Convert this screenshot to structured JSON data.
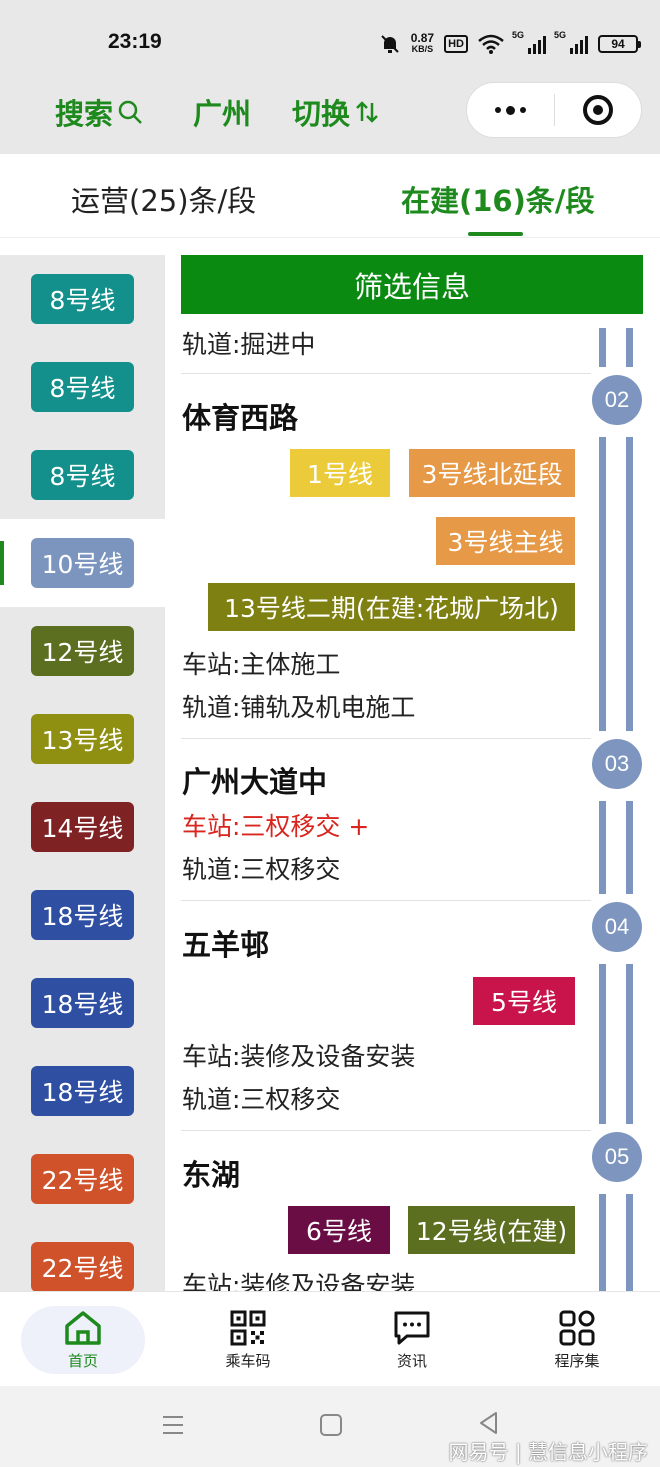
{
  "status": {
    "time": "23:19",
    "speed_value": "0.87",
    "speed_unit": "KB/S",
    "hd": "HD",
    "net1": "5G",
    "net2": "5G",
    "battery": "94"
  },
  "header": {
    "search_label": "搜索",
    "city_label": "广州",
    "switch_label": "切换"
  },
  "tabs": [
    {
      "label": "运营(25)条/段"
    },
    {
      "label": "在建(16)条/段"
    }
  ],
  "sidebar": {
    "items": [
      {
        "label": "8号线",
        "color": "#13908c"
      },
      {
        "label": "8号线",
        "color": "#13908c"
      },
      {
        "label": "8号线",
        "color": "#13908c"
      },
      {
        "label": "10号线",
        "color": "#7b95bf"
      },
      {
        "label": "12号线",
        "color": "#5c6e1f"
      },
      {
        "label": "13号线",
        "color": "#8f8f12"
      },
      {
        "label": "14号线",
        "color": "#7e2224"
      },
      {
        "label": "18号线",
        "color": "#2f4fa2"
      },
      {
        "label": "18号线",
        "color": "#2f4fa2"
      },
      {
        "label": "18号线",
        "color": "#2f4fa2"
      },
      {
        "label": "22号线",
        "color": "#d0522a"
      },
      {
        "label": "22号线",
        "color": "#d0522a"
      }
    ]
  },
  "main": {
    "filter_label": "筛选信息",
    "top_track": "轨道:掘进中",
    "stations": [
      {
        "no": "02",
        "name": "体育西路",
        "transfers": [
          {
            "label": "1号线",
            "color": "#eccb3a"
          },
          {
            "label": "3号线北延段",
            "color": "#e69a48"
          },
          {
            "label": "3号线主线",
            "color": "#e69a48"
          },
          {
            "label": "13号线二期(在建:花城广场北)",
            "color": "#7f8012"
          }
        ],
        "station_status": "车站:主体施工",
        "track_status": "轨道:铺轨及机电施工"
      },
      {
        "no": "03",
        "name": "广州大道中",
        "transfers": [],
        "station_status": "车站:三权移交 +",
        "track_status": "轨道:三权移交"
      },
      {
        "no": "04",
        "name": "五羊邨",
        "transfers": [
          {
            "label": "5号线",
            "color": "#c8134b"
          }
        ],
        "station_status": "车站:装修及设备安装",
        "track_status": "轨道:三权移交"
      },
      {
        "no": "05",
        "name": "东湖",
        "transfers": [
          {
            "label": "6号线",
            "color": "#6a0d45"
          },
          {
            "label": "12号线(在建)",
            "color": "#5c6e1f"
          }
        ],
        "station_status": "车站:装修及设备安装"
      }
    ]
  },
  "bottom_nav": [
    {
      "label": "首页"
    },
    {
      "label": "乘车码"
    },
    {
      "label": "资讯"
    },
    {
      "label": "程序集"
    }
  ],
  "watermark": "网易号 | 慧信息小程序"
}
